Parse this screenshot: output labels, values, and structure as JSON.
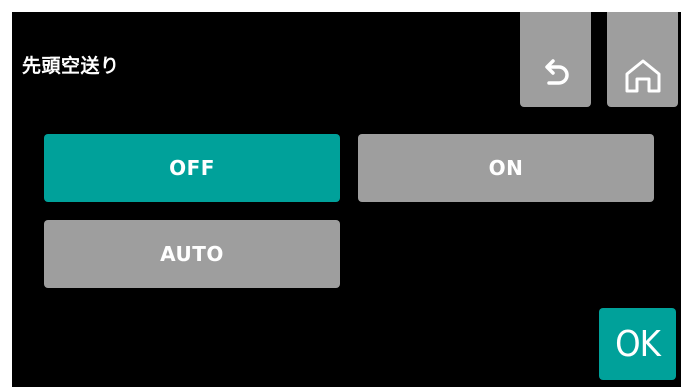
{
  "header": {
    "title": "先頭空送り",
    "back_icon": "undo-arrow-icon",
    "home_icon": "home-icon"
  },
  "options": [
    {
      "id": "off",
      "label": "OFF",
      "selected": true
    },
    {
      "id": "on",
      "label": "ON",
      "selected": false
    },
    {
      "id": "auto",
      "label": "AUTO",
      "selected": false
    }
  ],
  "footer": {
    "ok_label": "OK"
  },
  "colors": {
    "background": "#000000",
    "selected": "#00a19a",
    "unselected": "#9e9e9e",
    "text": "#ffffff"
  }
}
